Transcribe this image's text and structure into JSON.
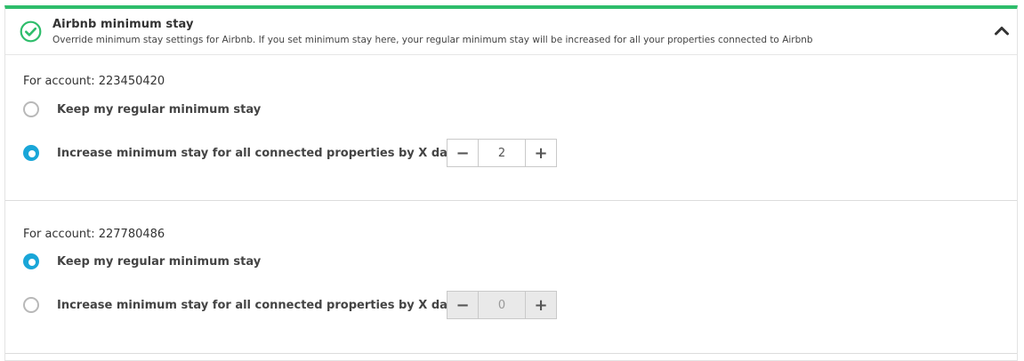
{
  "header": {
    "title": "Airbnb minimum stay",
    "subtitle": "Override minimum stay settings for Airbnb. If you set minimum stay here, your regular minimum stay will be increased for all your properties connected to Airbnb",
    "accent_color": "#2ebd6b"
  },
  "accounts": [
    {
      "label": "For account: 223450420",
      "options": [
        {
          "label": "Keep my regular minimum stay",
          "checked": false
        },
        {
          "label": "Increase minimum stay for all connected properties by X days",
          "checked": true
        }
      ],
      "stepper": {
        "value": "2",
        "minus": "−",
        "plus": "+",
        "disabled": false
      }
    },
    {
      "label": "For account: 227780486",
      "options": [
        {
          "label": "Keep my regular minimum stay",
          "checked": true
        },
        {
          "label": "Increase minimum stay for all connected properties by X days",
          "checked": false
        }
      ],
      "stepper": {
        "value": "0",
        "minus": "−",
        "plus": "+",
        "disabled": true
      }
    }
  ],
  "colors": {
    "radio_checked": "#19a6d8",
    "radio_unchecked_border": "#b8b8b8"
  }
}
